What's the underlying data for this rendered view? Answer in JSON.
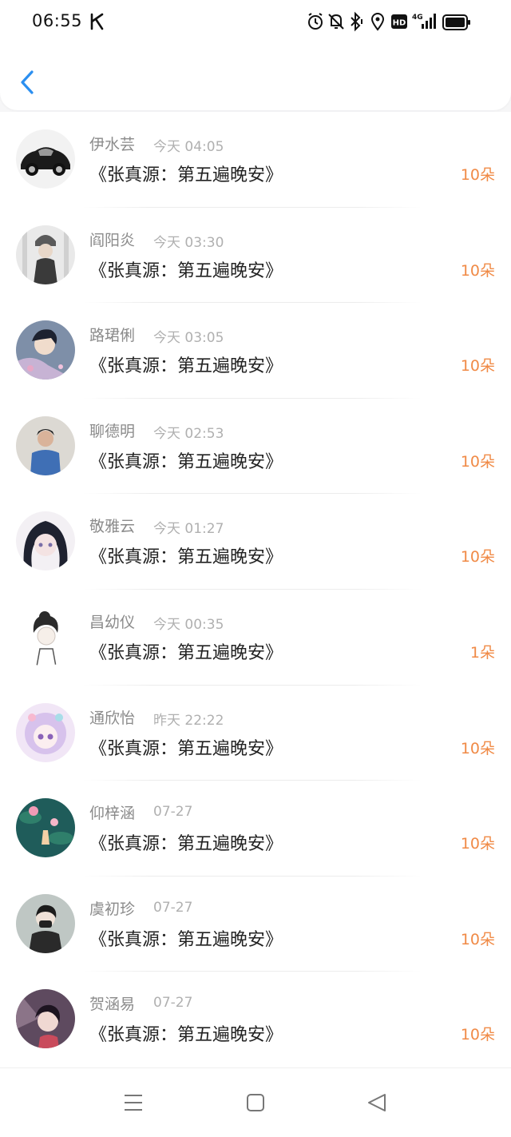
{
  "status_bar": {
    "time": "06:55",
    "icons": [
      "k-app-icon",
      "alarm-icon",
      "mute-icon",
      "bluetooth-icon",
      "location-icon",
      "hd-icon",
      "4g-signal-icon",
      "battery-icon"
    ],
    "network_label": "4G",
    "hd_label": "HD"
  },
  "header": {
    "back_icon": "chevron-left-icon",
    "accent": "#2b8ff0"
  },
  "list": {
    "title_color": "#222222",
    "count_color": "#f08a46",
    "items": [
      {
        "name": "伊水芸",
        "time": "今天 04:05",
        "title": "《张真源：第五遍晚安》",
        "count": "10朵",
        "avatar": "car-avatar"
      },
      {
        "name": "阎阳炎",
        "time": "今天 03:30",
        "title": "《张真源：第五遍晚安》",
        "count": "10朵",
        "avatar": "girl-beanie-avatar"
      },
      {
        "name": "路珺俐",
        "time": "今天 03:05",
        "title": "《张真源：第五遍晚安》",
        "count": "10朵",
        "avatar": "anime-boy-avatar"
      },
      {
        "name": "聊德明",
        "time": "今天 02:53",
        "title": "《张真源：第五遍晚安》",
        "count": "10朵",
        "avatar": "boy-photo-avatar"
      },
      {
        "name": "敬雅云",
        "time": "今天 01:27",
        "title": "《张真源：第五遍晚安》",
        "count": "10朵",
        "avatar": "anime-girl-avatar"
      },
      {
        "name": "昌幼仪",
        "time": "今天 00:35",
        "title": "《张真源：第五遍晚安》",
        "count": "1朵",
        "avatar": "sketch-girl-avatar"
      },
      {
        "name": "通欣怡",
        "time": "昨天 22:22",
        "title": "《张真源：第五遍晚安》",
        "count": "10朵",
        "avatar": "chibi-girl-avatar"
      },
      {
        "name": "仰梓涵",
        "time": "07-27",
        "title": "《张真源：第五遍晚安》",
        "count": "10朵",
        "avatar": "lotus-pond-avatar"
      },
      {
        "name": "虞初珍",
        "time": "07-27",
        "title": "《张真源：第五遍晚安》",
        "count": "10朵",
        "avatar": "masked-boy-avatar"
      },
      {
        "name": "贺涵易",
        "time": "07-27",
        "title": "《张真源：第五遍晚安》",
        "count": "10朵",
        "avatar": "dark-anime-avatar"
      }
    ]
  },
  "nav_bar": {
    "icons": [
      "menu-icon",
      "home-square-icon",
      "back-triangle-icon"
    ]
  }
}
